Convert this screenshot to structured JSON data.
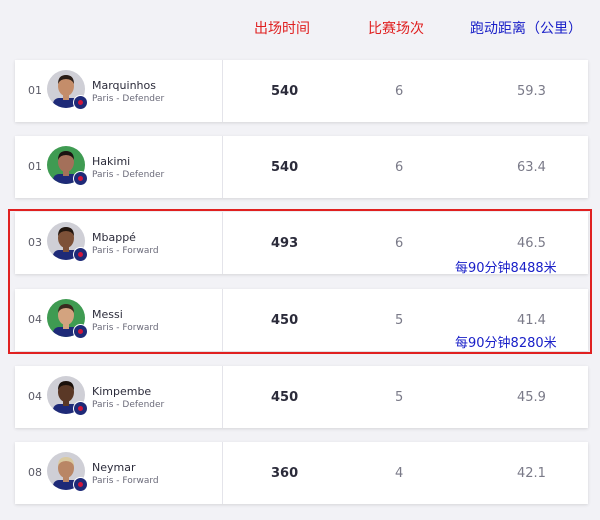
{
  "header": {
    "time": "出场时间",
    "matches": "比赛场次",
    "distance": "跑动距离（公里）"
  },
  "players": [
    {
      "rank": "01",
      "name": "Marquinhos",
      "team": "Paris - Defender",
      "time": "540",
      "matches": "6",
      "distance": "59.3",
      "skin": "#c48d6a",
      "hair": "#2a1d17",
      "bg": "#cfcfd6"
    },
    {
      "rank": "01",
      "name": "Hakimi",
      "team": "Paris - Defender",
      "time": "540",
      "matches": "6",
      "distance": "63.4",
      "skin": "#a4705a",
      "hair": "#1b1412",
      "bg": "#3f9b52"
    },
    {
      "rank": "03",
      "name": "Mbappé",
      "team": "Paris - Forward",
      "time": "493",
      "matches": "6",
      "distance": "46.5",
      "skin": "#7d5138",
      "hair": "#22160f",
      "bg": "#cfcfd6"
    },
    {
      "rank": "04",
      "name": "Messi",
      "team": "Paris - Forward",
      "time": "450",
      "matches": "5",
      "distance": "41.4",
      "skin": "#d3a37f",
      "hair": "#3a2a1f",
      "bg": "#3f9b52"
    },
    {
      "rank": "04",
      "name": "Kimpembe",
      "team": "Paris - Defender",
      "time": "450",
      "matches": "5",
      "distance": "45.9",
      "skin": "#5a3826",
      "hair": "#1a100b",
      "bg": "#cfcfd6"
    },
    {
      "rank": "08",
      "name": "Neymar",
      "team": "Paris - Forward",
      "time": "360",
      "matches": "4",
      "distance": "42.1",
      "skin": "#b98665",
      "hair": "#d9c9a0",
      "bg": "#cfcfd6"
    }
  ],
  "annotations": {
    "mbappe_per90": "每90分钟8488米",
    "messi_per90": "每90分钟8280米"
  },
  "colors": {
    "header_red": "#e02020",
    "header_blue": "#1a20c8",
    "highlight_border": "#e02020",
    "kit_navy": "#1e2a78"
  }
}
